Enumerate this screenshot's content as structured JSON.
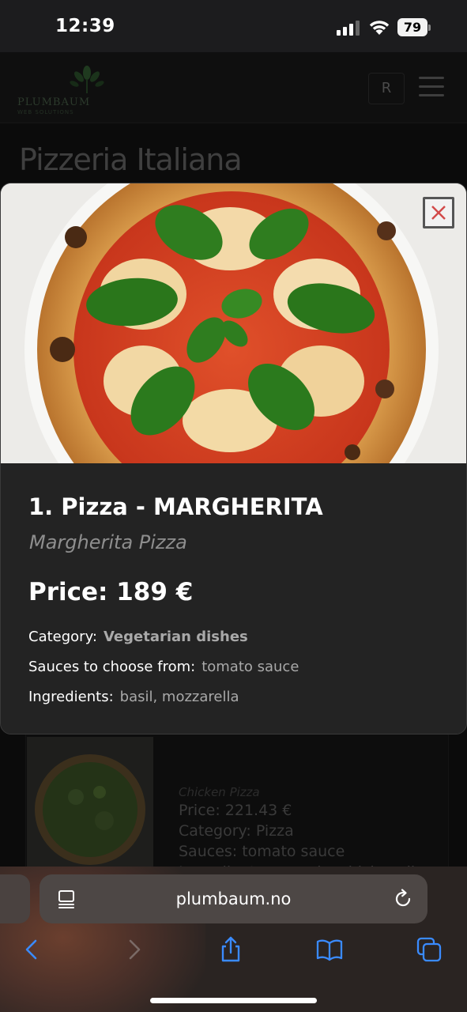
{
  "status_bar": {
    "time": "12:39",
    "battery": "79",
    "icons": [
      "cellular-signal-icon",
      "wifi-icon",
      "battery-icon"
    ]
  },
  "site": {
    "logo_text": "PLUMBAUM",
    "logo_subtext": "WEB SOLUTIONS",
    "language_button": "R",
    "page_title": "Pizzeria Italiana"
  },
  "background_card": {
    "subtitle": "Chicken Pizza",
    "price": "Price: 221.43 €",
    "category": "Category: Pizza",
    "sauces": "Sauces: tomato sauce",
    "ingredients": "Ingredients: arugula, chicken, lime..."
  },
  "modal": {
    "title": "1. Pizza - MARGHERITA",
    "subtitle": "Margherita Pizza",
    "price": "Price: 189 €",
    "category_label": "Category:",
    "category_value": "Vegetarian dishes",
    "sauces_label": "Sauces to choose from:",
    "sauces_value": "tomato sauce",
    "ingredients_label": "Ingredients:",
    "ingredients_value": "basil, mozzarella"
  },
  "browser": {
    "url": "plumbaum.no",
    "toolbar": [
      "back-icon",
      "forward-icon",
      "share-icon",
      "bookmarks-icon",
      "tabs-icon"
    ],
    "accent_color": "#3a8bff"
  }
}
